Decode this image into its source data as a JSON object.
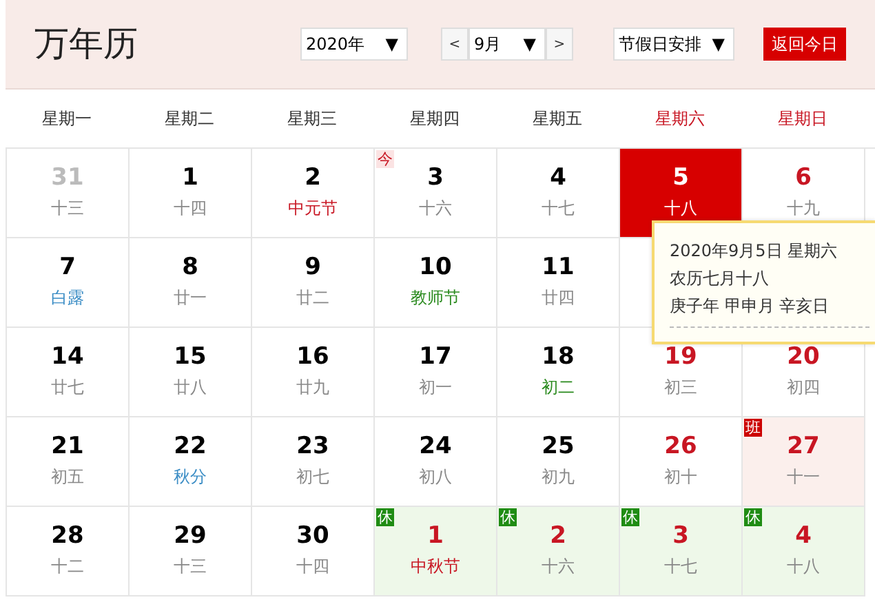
{
  "title": "万年历",
  "controls": {
    "year": {
      "value": "2020年",
      "arrow": "▼"
    },
    "prev": "<",
    "month": {
      "value": "9月",
      "arrow": "▼"
    },
    "next": ">",
    "holiday": {
      "value": "节假日安排",
      "arrow": "▼"
    },
    "today_button": "返回今日"
  },
  "weekdays": [
    {
      "label": "星期一",
      "weekend": false
    },
    {
      "label": "星期二",
      "weekend": false
    },
    {
      "label": "星期三",
      "weekend": false
    },
    {
      "label": "星期四",
      "weekend": false
    },
    {
      "label": "星期五",
      "weekend": false
    },
    {
      "label": "星期六",
      "weekend": true
    },
    {
      "label": "星期日",
      "weekend": true
    }
  ],
  "weeks": [
    [
      {
        "day": "31",
        "lunar": "十三",
        "color": "#888888",
        "other_month": true,
        "selected": false
      },
      {
        "day": "1",
        "lunar": "十四",
        "color": "#888888",
        "weekend": false,
        "other_month": false,
        "selected": false
      },
      {
        "day": "2",
        "lunar": "中元节",
        "color": "#c81623",
        "weekend": false,
        "other_month": false,
        "selected": false
      },
      {
        "day": "3",
        "lunar": "十六",
        "color": "#888888",
        "weekend": false,
        "other_month": false,
        "selected": false,
        "badge": {
          "kind": "today",
          "text": "今"
        }
      },
      {
        "day": "4",
        "lunar": "十七",
        "color": "#888888",
        "weekend": false,
        "other_month": false,
        "selected": false
      },
      {
        "day": "5",
        "lunar": "十八",
        "color": "#ffffff",
        "weekend": true,
        "other_month": false,
        "selected": true
      },
      {
        "day": "6",
        "lunar": "十九",
        "color": "#888888",
        "weekend": true,
        "other_month": false,
        "selected": false
      }
    ],
    [
      {
        "day": "7",
        "lunar": "白露",
        "color": "#3b8dc5",
        "weekend": false,
        "other_month": false,
        "selected": false
      },
      {
        "day": "8",
        "lunar": "廿一",
        "color": "#888888",
        "weekend": false,
        "other_month": false,
        "selected": false
      },
      {
        "day": "9",
        "lunar": "廿二",
        "color": "#888888",
        "weekend": false,
        "other_month": false,
        "selected": false
      },
      {
        "day": "10",
        "lunar": "教师节",
        "color": "#2a8a1e",
        "weekend": false,
        "other_month": false,
        "selected": false
      },
      {
        "day": "11",
        "lunar": "廿四",
        "color": "#888888",
        "weekend": false,
        "other_month": false,
        "selected": false
      }
    ],
    [
      {
        "day": "14",
        "lunar": "廿七",
        "color": "#888888",
        "weekend": false,
        "other_month": false,
        "selected": false
      },
      {
        "day": "15",
        "lunar": "廿八",
        "color": "#888888",
        "weekend": false,
        "other_month": false,
        "selected": false
      },
      {
        "day": "16",
        "lunar": "廿九",
        "color": "#888888",
        "weekend": false,
        "other_month": false,
        "selected": false
      },
      {
        "day": "17",
        "lunar": "初一",
        "color": "#888888",
        "weekend": false,
        "other_month": false,
        "selected": false
      },
      {
        "day": "18",
        "lunar": "初二",
        "color": "#2a8a1e",
        "weekend": false,
        "other_month": false,
        "selected": false
      },
      {
        "day": "19",
        "lunar": "初三",
        "color": "#888888",
        "weekend": true,
        "other_month": false,
        "selected": false
      },
      {
        "day": "20",
        "lunar": "初四",
        "color": "#888888",
        "weekend": true,
        "other_month": false,
        "selected": false
      }
    ],
    [
      {
        "day": "21",
        "lunar": "初五",
        "color": "#888888",
        "weekend": false,
        "other_month": false,
        "selected": false
      },
      {
        "day": "22",
        "lunar": "秋分",
        "color": "#3b8dc5",
        "weekend": false,
        "other_month": false,
        "selected": false
      },
      {
        "day": "23",
        "lunar": "初七",
        "color": "#888888",
        "weekend": false,
        "other_month": false,
        "selected": false
      },
      {
        "day": "24",
        "lunar": "初八",
        "color": "#888888",
        "weekend": false,
        "other_month": false,
        "selected": false
      },
      {
        "day": "25",
        "lunar": "初九",
        "color": "#888888",
        "weekend": false,
        "other_month": false,
        "selected": false
      },
      {
        "day": "26",
        "lunar": "初十",
        "color": "#888888",
        "weekend": true,
        "other_month": false,
        "selected": false
      },
      {
        "day": "27",
        "lunar": "十一",
        "color": "#888888",
        "weekend": true,
        "other_month": false,
        "selected": false,
        "badge": {
          "kind": "workday",
          "text": "班"
        }
      }
    ],
    [
      {
        "day": "28",
        "lunar": "十二",
        "color": "#888888",
        "weekend": false,
        "other_month": false,
        "selected": false
      },
      {
        "day": "29",
        "lunar": "十三",
        "color": "#888888",
        "weekend": false,
        "other_month": false,
        "selected": false
      },
      {
        "day": "30",
        "lunar": "十四",
        "color": "#888888",
        "weekend": false,
        "other_month": false,
        "selected": false
      },
      {
        "day": "1",
        "lunar": "中秋节",
        "color": "#c81623",
        "weekend": true,
        "other_month": false,
        "selected": false,
        "badge": {
          "kind": "rest",
          "text": "休"
        }
      },
      {
        "day": "2",
        "lunar": "十六",
        "color": "#888888",
        "weekend": true,
        "other_month": false,
        "selected": false,
        "badge": {
          "kind": "rest",
          "text": "休"
        }
      },
      {
        "day": "3",
        "lunar": "十七",
        "color": "#888888",
        "weekend": true,
        "other_month": false,
        "selected": false,
        "badge": {
          "kind": "rest",
          "text": "休"
        }
      },
      {
        "day": "4",
        "lunar": "十八",
        "color": "#888888",
        "weekend": true,
        "other_month": false,
        "selected": false,
        "badge": {
          "kind": "rest",
          "text": "休"
        }
      }
    ]
  ],
  "tooltip": {
    "lines": [
      "2020年9月5日 星期六",
      "农历七月十八",
      "庚子年 甲申月 辛亥日"
    ]
  }
}
